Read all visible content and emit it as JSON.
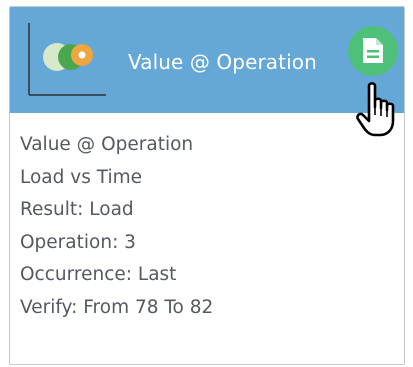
{
  "card": {
    "title": "Value @ Operation",
    "header_icon": "scatter-chart-icon",
    "action_icon": "document-icon",
    "accent_colors": {
      "header": "#65a7d6",
      "action_button": "#4fc079"
    },
    "details": [
      "Value @ Operation",
      "Load vs Time",
      "Result: Load",
      "Operation: 3",
      "Occurrence: Last",
      "Verify: From 78 To 82"
    ]
  },
  "cursor": "hand-pointer-cursor"
}
